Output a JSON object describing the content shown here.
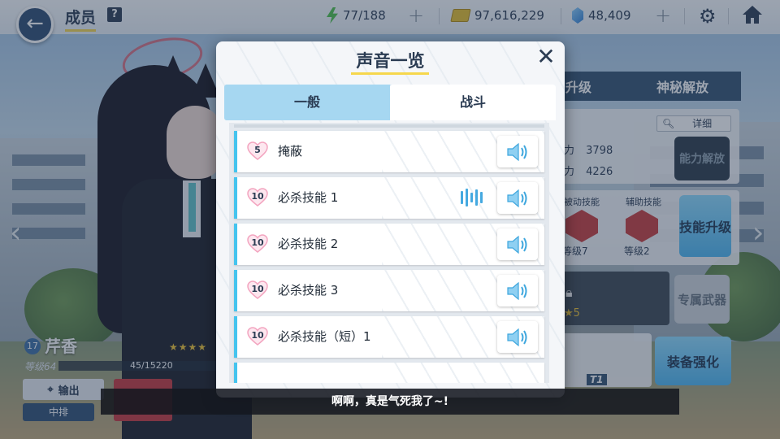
{
  "header": {
    "title": "成员",
    "help_label": "?",
    "stamina": "77/188",
    "credits": "97,616,229",
    "gems": "48,409",
    "plus": "+"
  },
  "side_panel": {
    "tab_upgrade": "升级",
    "tab_mystery": "神秘解放",
    "detail_label": "详细",
    "stat_1_label": "力",
    "stat_1_value": "3798",
    "stat_2_label": "力",
    "stat_2_value": "4226",
    "ability_unlock": "能力解放",
    "skill_1_title": "被动技能",
    "skill_1_level": "等级7",
    "skill_2_title": "辅助技能",
    "skill_2_level": "等级2",
    "skill_upgrade": "技能升级",
    "weapon_stars": "5",
    "exclusive_weapon": "专属武器",
    "gear_tier": "T1",
    "gear_enhance": "装备强化"
  },
  "character": {
    "level_badge": "17",
    "name": "芹香",
    "stars": "★★★★",
    "level_text": "等级64",
    "exp": "45/15220",
    "role": "输出",
    "position": "中排"
  },
  "modal": {
    "title": "声音一览",
    "close": "✕",
    "tabs": [
      {
        "label": "一般",
        "active": false
      },
      {
        "label": "战斗",
        "active": true
      }
    ],
    "rows": [
      {
        "bond": "5",
        "label": "掩蔽",
        "playing": false
      },
      {
        "bond": "10",
        "label": "必杀技能 1",
        "playing": true
      },
      {
        "bond": "10",
        "label": "必杀技能 2",
        "playing": false
      },
      {
        "bond": "10",
        "label": "必杀技能 3",
        "playing": false
      },
      {
        "bond": "10",
        "label": "必杀技能（短）1",
        "playing": false
      }
    ]
  },
  "subtitle": "啊啊，真是气死我了~!",
  "colors": {
    "accent_blue": "#45c4ee",
    "title_underline": "#f6d74d",
    "heart_pink": "#f7b6cc",
    "navy": "#2a3b52"
  },
  "icons": [
    "back-arrow-icon",
    "stamina-bolt-icon",
    "credit-icon",
    "gem-icon",
    "gear-icon",
    "home-icon",
    "speaker-icon",
    "heart-icon",
    "close-icon",
    "search-icon"
  ]
}
